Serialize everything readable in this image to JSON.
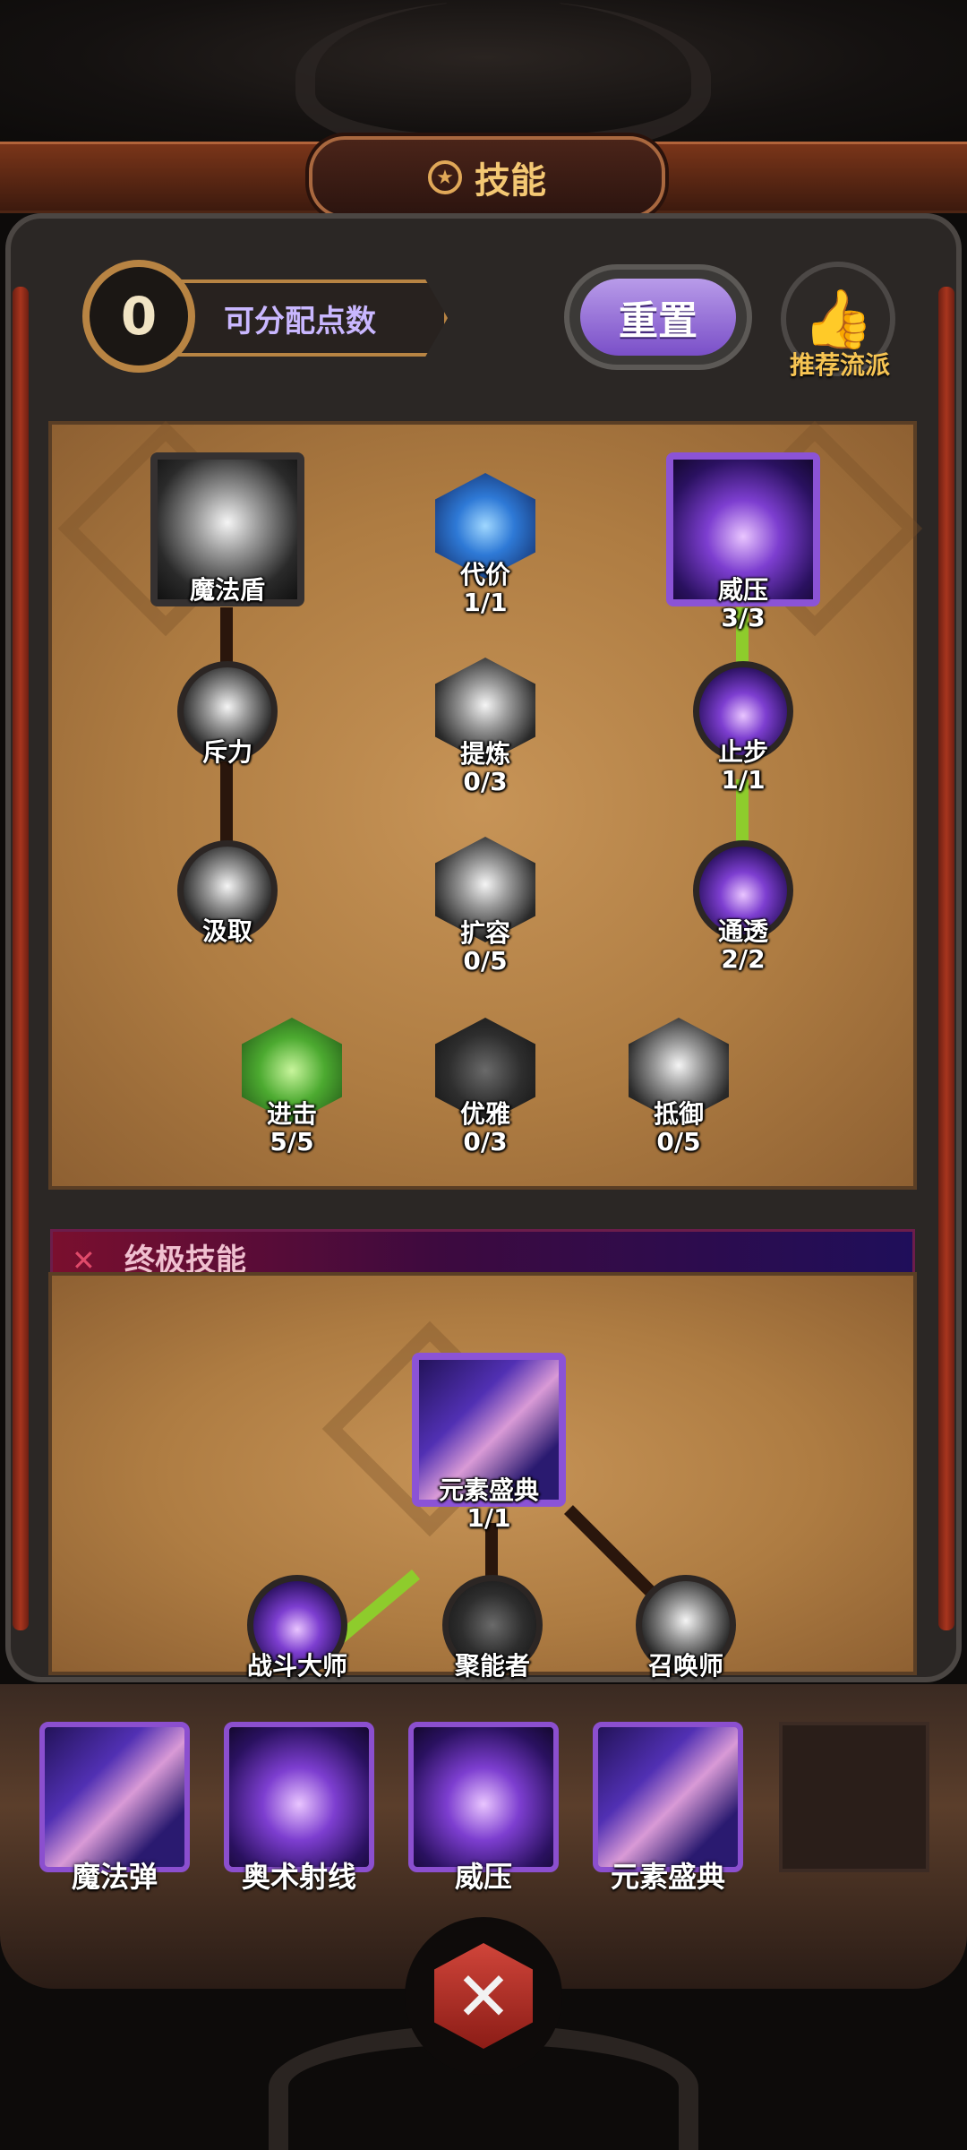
{
  "header": {
    "title": "技能"
  },
  "points": {
    "value": "0",
    "label": "可分配点数"
  },
  "reset_label": "重置",
  "recommend_label": "推荐流派",
  "tree": {
    "nodes": [
      {
        "name": "魔法盾",
        "level": ""
      },
      {
        "name": "代价",
        "level": "1/1"
      },
      {
        "name": "威压",
        "level": "3/3"
      },
      {
        "name": "斥力",
        "level": ""
      },
      {
        "name": "提炼",
        "level": "0/3"
      },
      {
        "name": "止步",
        "level": "1/1"
      },
      {
        "name": "汲取",
        "level": ""
      },
      {
        "name": "扩容",
        "level": "0/5"
      },
      {
        "name": "通透",
        "level": "2/2"
      },
      {
        "name": "进击",
        "level": "5/5"
      },
      {
        "name": "优雅",
        "level": "0/3"
      },
      {
        "name": "抵御",
        "level": "0/5"
      }
    ]
  },
  "ultimate": {
    "header": "终极技能",
    "main": {
      "name": "元素盛典",
      "level": "1/1"
    },
    "options": [
      "战斗大师",
      "聚能者",
      "召唤师"
    ]
  },
  "equipped": [
    "魔法弹",
    "奥术射线",
    "威压",
    "元素盛典"
  ],
  "colors": {
    "accent_purple": "#8b53d6",
    "gold": "#f4c873",
    "link_green": "#8ecc2c",
    "panel_tan": "#b07f45"
  }
}
